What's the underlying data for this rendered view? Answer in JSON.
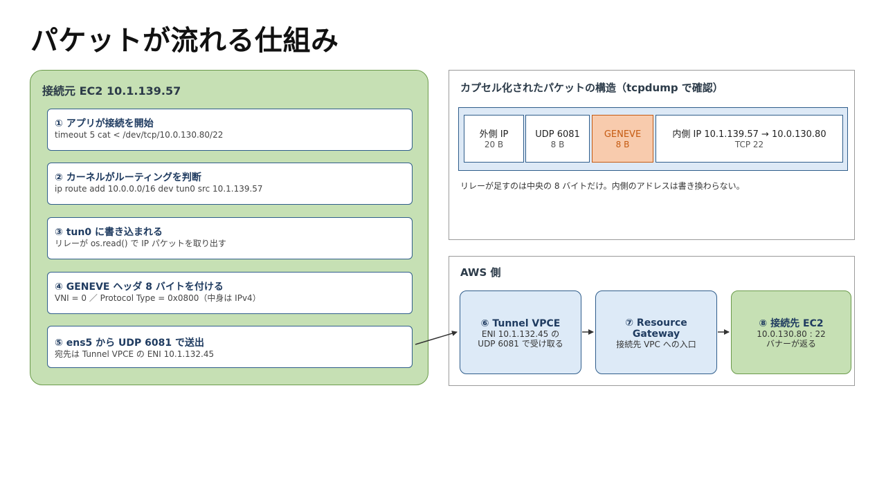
{
  "title": "パケットが流れる仕組み",
  "source": {
    "title": "接続元 EC2  10.1.139.57",
    "steps": [
      {
        "title": "① アプリが接続を開始",
        "sub": "timeout 5 cat < /dev/tcp/10.0.130.80/22"
      },
      {
        "title": "② カーネルがルーティングを判断",
        "sub": "ip route add 10.0.0.0/16 dev tun0 src 10.1.139.57"
      },
      {
        "title": "③ tun0 に書き込まれる",
        "sub": "リレーが os.read() で IP パケットを取り出す"
      },
      {
        "title": "④ GENEVE ヘッダ 8 バイトを付ける",
        "sub": "VNI = 0 ／ Protocol Type = 0x0800（中身は IPv4）"
      },
      {
        "title": "⑤ ens5 から UDP 6081 で送出",
        "sub": "宛先は Tunnel VPCE の ENI 10.1.132.45"
      }
    ]
  },
  "capsule": {
    "title": "カプセル化されたパケットの構造（tcpdump で確認）",
    "segments": [
      {
        "label": "外側 IP",
        "size": "20 B"
      },
      {
        "label": "UDP 6081",
        "size": "8 B"
      },
      {
        "label": "GENEVE",
        "size": "8 B"
      },
      {
        "label": "内側 IP  10.1.139.57 → 10.0.130.80",
        "size": "TCP 22"
      }
    ],
    "note": "リレーが足すのは中央の 8 バイトだけ。内側のアドレスは書き換わらない。",
    "colors": {
      "geneve_fill": "#f8cbad",
      "geneve_text": "#c55a11"
    }
  },
  "aws": {
    "title": "AWS 側",
    "nodes": [
      {
        "title": "⑥ Tunnel VPCE",
        "sub1": "ENI 10.1.132.45 の",
        "sub2": "UDP 6081 で受け取る"
      },
      {
        "title": "⑦ Resource",
        "title2": "Gateway",
        "sub1": "接続先 VPC への入口"
      },
      {
        "title": "⑧ 接続先 EC2",
        "sub1": "10.0.130.80 : 22",
        "sub2": "バナーが返る"
      }
    ]
  },
  "colors": {
    "green": "#c6e0b4",
    "blue": "#ddeaf7",
    "border_blue": "#2e5c8a"
  }
}
